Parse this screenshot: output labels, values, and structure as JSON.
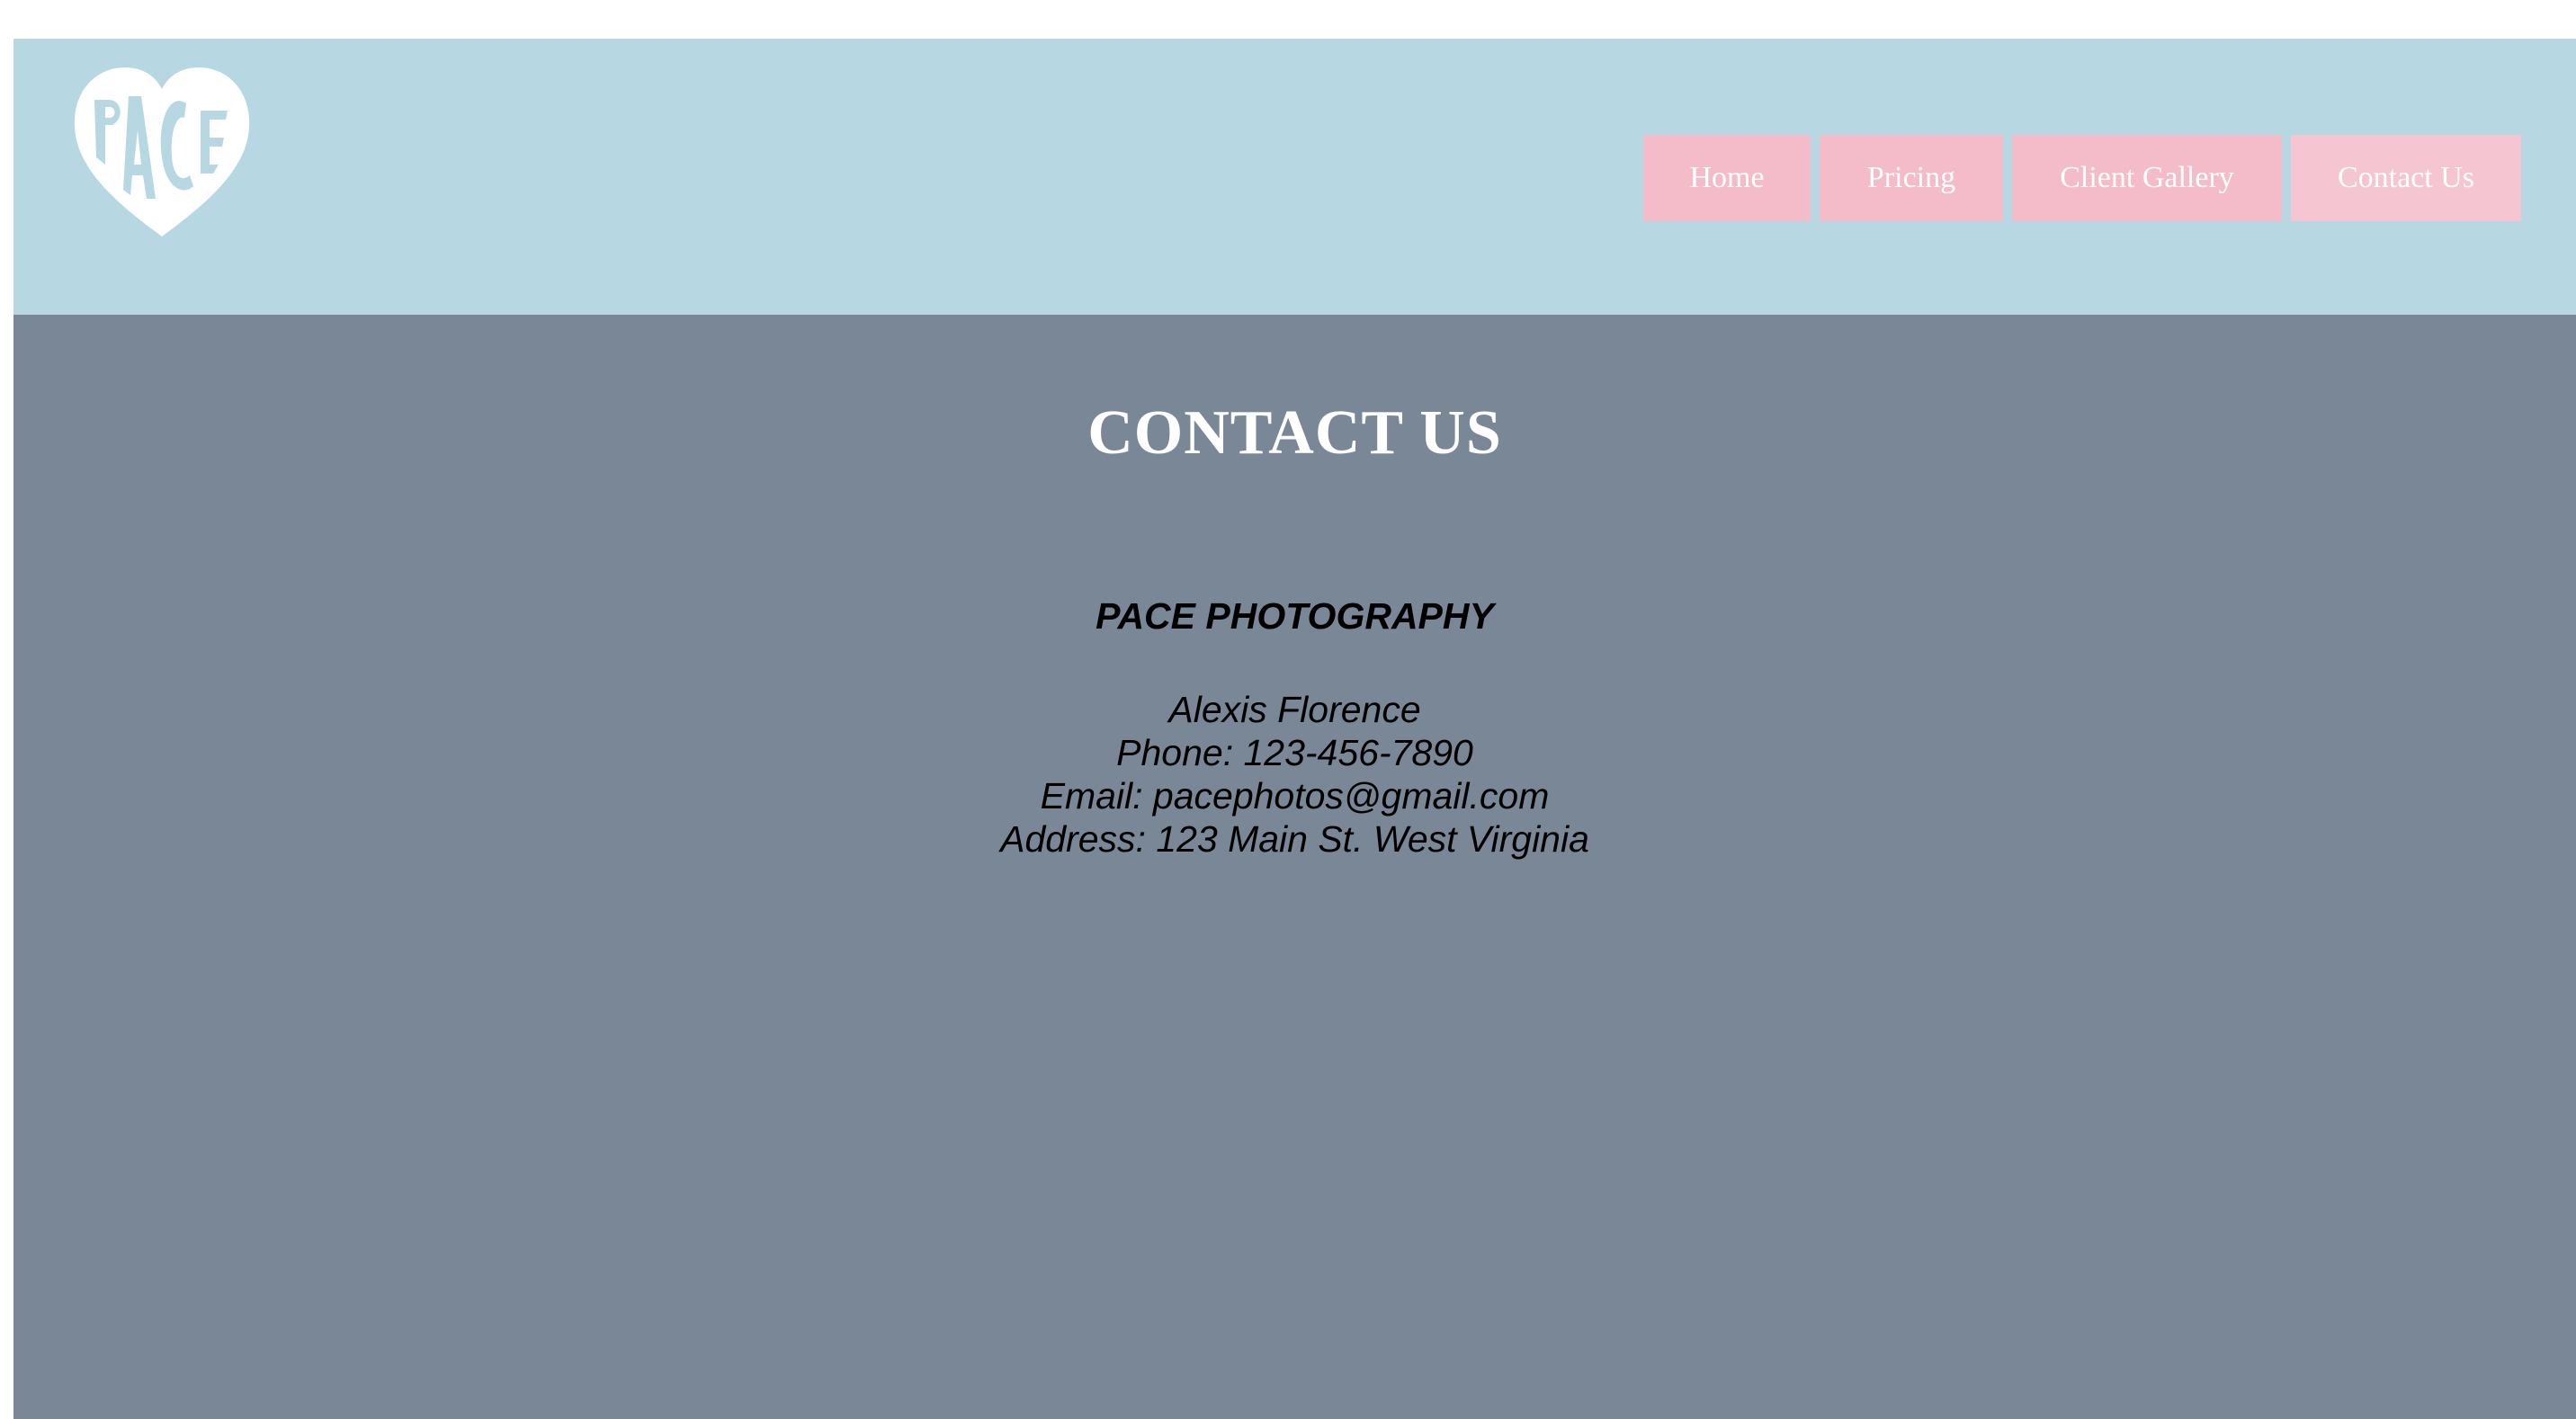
{
  "header": {
    "logo": {
      "icon": "pace-heart-logo-icon",
      "text": "PACE",
      "color": "#ffffff"
    },
    "background": "#b7d8e2",
    "nav": [
      {
        "label": "Home"
      },
      {
        "label": "Pricing"
      },
      {
        "label": "Client Gallery"
      },
      {
        "label": "Contact Us"
      }
    ],
    "nav_color": "#f4bcc8"
  },
  "main": {
    "background": "#7a8797",
    "title": "CONTACT US",
    "company": "PACE PHOTOGRAPHY",
    "contact": {
      "name": "Alexis Florence",
      "phone": "Phone: 123-456-7890",
      "email": "Email: pacephotos@gmail.com",
      "address": "Address: 123 Main St. West Virginia"
    }
  }
}
